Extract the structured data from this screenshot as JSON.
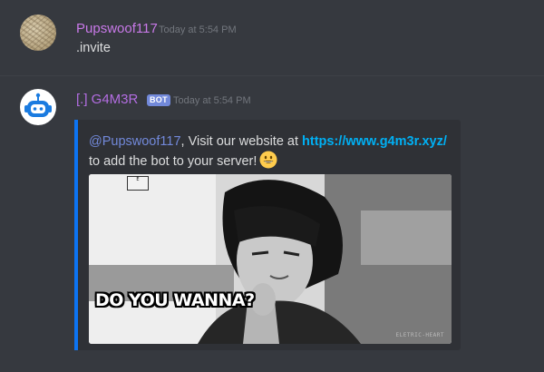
{
  "messages": [
    {
      "author": "Pupswoof117",
      "author_color": "#c879e8",
      "timestamp": "Today at 5:54 PM",
      "content": ".invite"
    },
    {
      "author": "[.] G4M3R",
      "author_color": "#b36de2",
      "badge": "BOT",
      "timestamp": "Today at 5:54 PM",
      "embed": {
        "accent_color": "#0d74f2",
        "mention": "@Pupswoof117",
        "text_before_link": ", Visit our website at ",
        "link": "https://www.g4m3r.xyz/",
        "text_after_link": "to add the bot to your server!",
        "emoji": "grinning-face",
        "image": {
          "caption": "DO YOU WANNA?",
          "watermark": "ELETRIC-HEART",
          "logo_text": "Ë"
        }
      }
    }
  ],
  "colors": {
    "background": "#36393f",
    "embed_bg": "#2f3136",
    "link": "#00b0f4",
    "mention": "#7289da",
    "badge_bg": "#7289da"
  }
}
